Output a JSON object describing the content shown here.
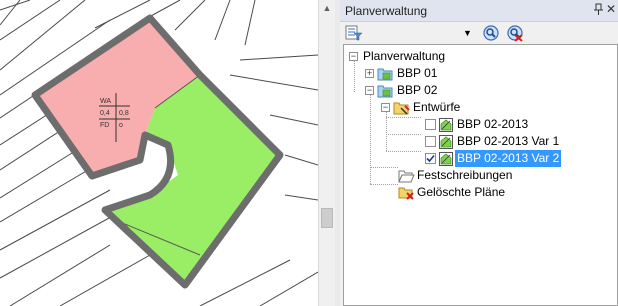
{
  "map": {
    "annotation": {
      "row1": [
        "WA",
        ""
      ],
      "row2": [
        "0,4",
        "0,8"
      ],
      "row3": [
        "FD",
        "o"
      ]
    },
    "colors": {
      "zone_pink": "#f8aeae",
      "zone_green": "#99ee66",
      "outline": "#6d6d6d"
    }
  },
  "panel": {
    "title": "Planverwaltung",
    "pin_icon": "pin-icon",
    "close_icon": "close-icon",
    "toolbar": {
      "filter_icon": "filter-icon",
      "dropdown_icon": "chevron-down-icon",
      "search_icon": "search-icon",
      "clear_search_icon": "search-clear-icon"
    },
    "tree": {
      "root": "Planverwaltung",
      "bbp01": "BBP 01",
      "bbp02": "BBP 02",
      "entwuerfe": "Entwürfe",
      "plans": [
        "BBP 02-2013",
        "BBP 02-2013 Var 1",
        "BBP 02-2013 Var 2"
      ],
      "plan_checked": [
        false,
        false,
        true
      ],
      "festschreibungen": "Festschreibungen",
      "geloeschte": "Gelöschte Pläne"
    },
    "accent_color": "#3399ff"
  }
}
